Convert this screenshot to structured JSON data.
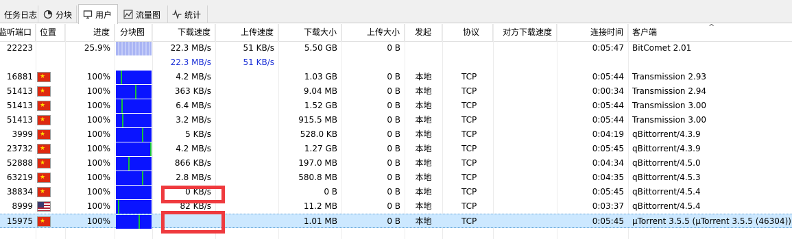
{
  "tabs": [
    {
      "label": "任务日志",
      "icon": "none"
    },
    {
      "label": "分块",
      "icon": "blocks-icon"
    },
    {
      "label": "用户",
      "icon": "monitor-icon"
    },
    {
      "label": "流量图",
      "icon": "traffic-chart-icon"
    },
    {
      "label": "统计",
      "icon": "pulse-icon"
    }
  ],
  "columns": [
    "监听端口",
    "位置",
    "进度",
    "分块图",
    "下载速度",
    "上传速度",
    "下载大小",
    "上传大小",
    "发起",
    "协议",
    "对方下载速度",
    "连接时间",
    "客户端"
  ],
  "sort_indicator": "^",
  "rows": [
    {
      "port": "22223",
      "flag": "",
      "progress": "25.9%",
      "pieces": "partial",
      "down_speed": "22.3 MB/s",
      "up_speed": "51 KB/s",
      "down_size": "5.50 GB",
      "up_size": "0 B",
      "initiator": "",
      "protocol": "",
      "peer_down": "",
      "time": "0:05:47",
      "client": "BitComet 2.01"
    },
    {
      "port": "",
      "flag": "",
      "progress": "",
      "pieces": "",
      "down_speed": "22.3 MB/s",
      "up_speed": "51 KB/s",
      "down_size": "",
      "up_size": "",
      "initiator": "",
      "protocol": "",
      "peer_down": "",
      "time": "",
      "client": "",
      "summary": true
    },
    {
      "port": "16881",
      "flag": "cn",
      "progress": "100%",
      "pieces": "full",
      "down_speed": "4.2 MB/s",
      "up_speed": "",
      "down_size": "1.03 GB",
      "up_size": "0 B",
      "initiator": "本地",
      "protocol": "TCP",
      "peer_down": "",
      "time": "0:05:44",
      "client": "Transmission 2.93"
    },
    {
      "port": "51413",
      "flag": "cn",
      "progress": "100%",
      "pieces": "full",
      "down_speed": "363 KB/s",
      "up_speed": "",
      "down_size": "9.04 MB",
      "up_size": "0 B",
      "initiator": "本地",
      "protocol": "TCP",
      "peer_down": "",
      "time": "0:00:34",
      "client": "Transmission 2.94"
    },
    {
      "port": "51413",
      "flag": "cn",
      "progress": "100%",
      "pieces": "full",
      "down_speed": "6.4 MB/s",
      "up_speed": "",
      "down_size": "1.52 GB",
      "up_size": "0 B",
      "initiator": "本地",
      "protocol": "TCP",
      "peer_down": "",
      "time": "0:05:44",
      "client": "Transmission 3.00"
    },
    {
      "port": "51413",
      "flag": "cn",
      "progress": "100%",
      "pieces": "full",
      "down_speed": "3.2 MB/s",
      "up_speed": "",
      "down_size": "915.5 MB",
      "up_size": "0 B",
      "initiator": "本地",
      "protocol": "TCP",
      "peer_down": "",
      "time": "0:05:44",
      "client": "Transmission 3.00"
    },
    {
      "port": "3999",
      "flag": "cn",
      "progress": "100%",
      "pieces": "full",
      "down_speed": "5 KB/s",
      "up_speed": "",
      "down_size": "528.0 KB",
      "up_size": "0 B",
      "initiator": "本地",
      "protocol": "TCP",
      "peer_down": "",
      "time": "0:04:19",
      "client": "qBittorrent/4.3.9"
    },
    {
      "port": "23732",
      "flag": "cn",
      "progress": "100%",
      "pieces": "full",
      "down_speed": "4.2 MB/s",
      "up_speed": "",
      "down_size": "1.27 GB",
      "up_size": "0 B",
      "initiator": "本地",
      "protocol": "TCP",
      "peer_down": "",
      "time": "0:05:45",
      "client": "qBittorrent/4.3.9"
    },
    {
      "port": "52888",
      "flag": "cn",
      "progress": "100%",
      "pieces": "full",
      "down_speed": "866 KB/s",
      "up_speed": "",
      "down_size": "197.0 MB",
      "up_size": "0 B",
      "initiator": "本地",
      "protocol": "TCP",
      "peer_down": "",
      "time": "0:04:34",
      "client": "qBittorrent/4.5.0"
    },
    {
      "port": "63219",
      "flag": "cn",
      "progress": "100%",
      "pieces": "full",
      "down_speed": "2.8 MB/s",
      "up_speed": "",
      "down_size": "580.8 MB",
      "up_size": "0 B",
      "initiator": "本地",
      "protocol": "TCP",
      "peer_down": "",
      "time": "0:04:35",
      "client": "qBittorrent/4.5.3"
    },
    {
      "port": "38834",
      "flag": "cn",
      "progress": "100%",
      "pieces": "full",
      "down_speed": "0 KB/s",
      "up_speed": "",
      "down_size": "0 B",
      "up_size": "0 B",
      "initiator": "本地",
      "protocol": "TCP",
      "peer_down": "",
      "time": "0:05:45",
      "client": "qBittorrent/4.5.4"
    },
    {
      "port": "8999",
      "flag": "us",
      "progress": "100%",
      "pieces": "full",
      "down_speed": "82 KB/s",
      "up_speed": "",
      "down_size": "11.2 MB",
      "up_size": "0 B",
      "initiator": "本地",
      "protocol": "TCP",
      "peer_down": "",
      "time": "0:03:37",
      "client": "qBittorrent/4.5.4"
    },
    {
      "port": "15975",
      "flag": "cn",
      "progress": "100%",
      "pieces": "full",
      "down_speed": "",
      "up_speed": "",
      "down_size": "1.01 MB",
      "up_size": "0 B",
      "initiator": "本地",
      "protocol": "TCP",
      "peer_down": "",
      "time": "0:05:45",
      "client": "µTorrent 3.5.5 (µTorrent 3.5.5 (46304))",
      "selected": true
    }
  ],
  "colors": {
    "piece_full": "#0a14ff",
    "piece_marker": "#18c23a",
    "highlight_box": "#ef3a3e",
    "selection": "#cce8ff",
    "summary_text": "#1a2fd6"
  }
}
